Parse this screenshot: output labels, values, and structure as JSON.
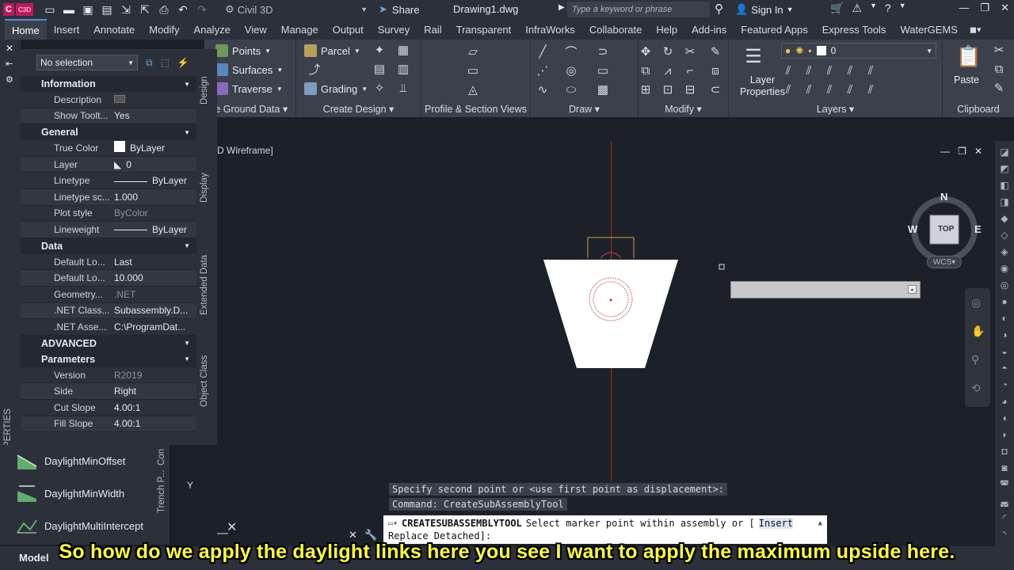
{
  "titlebar": {
    "app_logo": "C",
    "app_logo_sub": "C3D",
    "workspace": "Civil 3D",
    "share": "Share",
    "document": "Drawing1.dwg",
    "search_placeholder": "Type a keyword or phrase",
    "signin": "Sign In",
    "quick_access_icons": [
      "new-icon",
      "open-icon",
      "save-icon",
      "save-as-icon",
      "import-icon",
      "export-icon",
      "print-icon",
      "undo-icon",
      "redo-icon",
      "workspace-gear-icon"
    ]
  },
  "ribbon_tabs": [
    "Home",
    "Insert",
    "Annotate",
    "Modify",
    "Analyze",
    "View",
    "Manage",
    "Output",
    "Survey",
    "Rail",
    "Transparent",
    "InfraWorks",
    "Collaborate",
    "Help",
    "Add-ins",
    "Featured Apps",
    "Express Tools",
    "WaterGEMS"
  ],
  "ribbon": {
    "ground_data": {
      "title": "te Ground Data",
      "points": "Points",
      "surfaces": "Surfaces",
      "traverse": "Traverse"
    },
    "create_design": {
      "title": "Create Design",
      "parcel": "Parcel",
      "grading": "Grading"
    },
    "profile_section": {
      "title": "Profile & Section Views"
    },
    "draw": {
      "title": "Draw"
    },
    "modify": {
      "title": "Modify"
    },
    "layers": {
      "title": "Layers",
      "layer_properties_1": "Layer",
      "layer_properties_2": "Properties",
      "current_layer": "0"
    },
    "clipboard": {
      "title": "Clipboard",
      "paste": "Paste"
    }
  },
  "properties": {
    "selection": "No selection",
    "label": "PROPERTIES",
    "sections": {
      "information": "Information",
      "general": "General",
      "data": "Data",
      "advanced": "ADVANCED",
      "parameters": "Parameters"
    },
    "information_rows": [
      {
        "key": "Description",
        "value": ""
      },
      {
        "key": "Show Toolt...",
        "value": "Yes"
      }
    ],
    "general_rows": [
      {
        "key": "True Color",
        "value": "ByLayer"
      },
      {
        "key": "Layer",
        "value": "0"
      },
      {
        "key": "Linetype",
        "value": "ByLayer"
      },
      {
        "key": "Linetype sc...",
        "value": "1.000"
      },
      {
        "key": "Plot style",
        "value": "ByColor"
      },
      {
        "key": "Lineweight",
        "value": "ByLayer"
      }
    ],
    "data_rows": [
      {
        "key": "Default Lo...",
        "value": "Last"
      },
      {
        "key": "Default Lo...",
        "value": "10.000"
      },
      {
        "key": "Geometry...",
        "value": ".NET"
      },
      {
        "key": ".NET Class...",
        "value": "Subassembly.D..."
      },
      {
        "key": ".NET Asse...",
        "value": "C:\\ProgramDat..."
      }
    ],
    "parameter_rows": [
      {
        "key": "Version",
        "value": "R2019"
      },
      {
        "key": "Side",
        "value": "Right"
      },
      {
        "key": "Cut Slope",
        "value": "4.00:1"
      },
      {
        "key": "Fill Slope",
        "value": "4.00:1"
      }
    ],
    "vertical_tabs": [
      "Design",
      "Display",
      "Extended Data",
      "Object Class"
    ]
  },
  "tool_palette": {
    "items": [
      "DaylightMinOffset",
      "DaylightMinWidth",
      "DaylightMultiIntercept"
    ],
    "side_tabs": [
      "Con",
      "Trench P..."
    ]
  },
  "viewport": {
    "label": "D Wireframe]",
    "compass": {
      "n": "N",
      "s": "S",
      "e": "E",
      "w": "W",
      "top": "TOP"
    },
    "wcs": "WCS",
    "ucs_y": "Y"
  },
  "command": {
    "history_1": "Specify second point or <use first point as displacement>:",
    "history_2": "Command: CreateSubAssemblyTool",
    "prompt_name": "CREATESUBASSEMBLYTOOL",
    "prompt_text": "Select marker point within assembly or [",
    "prompt_opt1": "Insert",
    "prompt_line2": "Replace Detached]:"
  },
  "status": {
    "model": "Model"
  },
  "subtitle": "So how do we apply the daylight links here you see I want to apply the maximum upside here."
}
